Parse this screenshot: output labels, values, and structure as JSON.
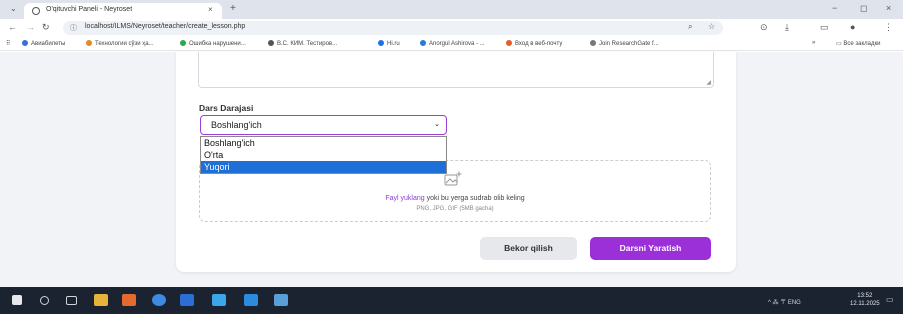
{
  "browser": {
    "tab": {
      "title": "O'qituvchi Paneli - Neyroset",
      "close": "×"
    },
    "new_tab": "+",
    "window_controls": {
      "minimize": "−",
      "maximize": "◻",
      "close": "×"
    },
    "address": {
      "url": "localhost/ILMS/Neyroset/teacher/create_lesson.php"
    },
    "bookmarks": [
      {
        "label": "Авиабилеты",
        "color": "#3a6fd8"
      },
      {
        "label": "Технологии сўзи ҳа...",
        "color": "#e08a2a"
      },
      {
        "label": "Ошибка нарушени...",
        "color": "#2aa84a"
      },
      {
        "label": "В.С. КИМ. Тестиров...",
        "color": "#555555"
      },
      {
        "label": "Hi.ru",
        "color": "#1a73e8"
      },
      {
        "label": "Anorgul Ashirova - ...",
        "color": "#2a7ad8"
      },
      {
        "label": "Вход в веб-почту",
        "color": "#e0602a"
      },
      {
        "label": "Join ResearchGate f...",
        "color": "#777777"
      }
    ],
    "bookmarks_more": "»",
    "other_bookmarks": "Все закладки"
  },
  "form": {
    "level_label": "Dars Darajasi",
    "level_select": {
      "selected": "Boshlang'ich",
      "options": [
        "Boshlang'ich",
        "O'rta",
        "Yuqori"
      ],
      "highlighted_index": 2
    },
    "upload": {
      "link_text": "Fayl yuklang",
      "rest_text": " yoki bu yerga sudrab olib keling",
      "hint": "PNG, JPG, GIF (5MB gacha)"
    },
    "cancel_label": "Bekor qilish",
    "submit_label": "Darsni Yaratish"
  },
  "taskbar": {
    "tray_text": "^ ⁂ 〒 ENG",
    "time": "13:52",
    "date": "12.11.2025"
  },
  "colors": {
    "accent": "#9b30d9",
    "selection": "#1e6fd8"
  }
}
